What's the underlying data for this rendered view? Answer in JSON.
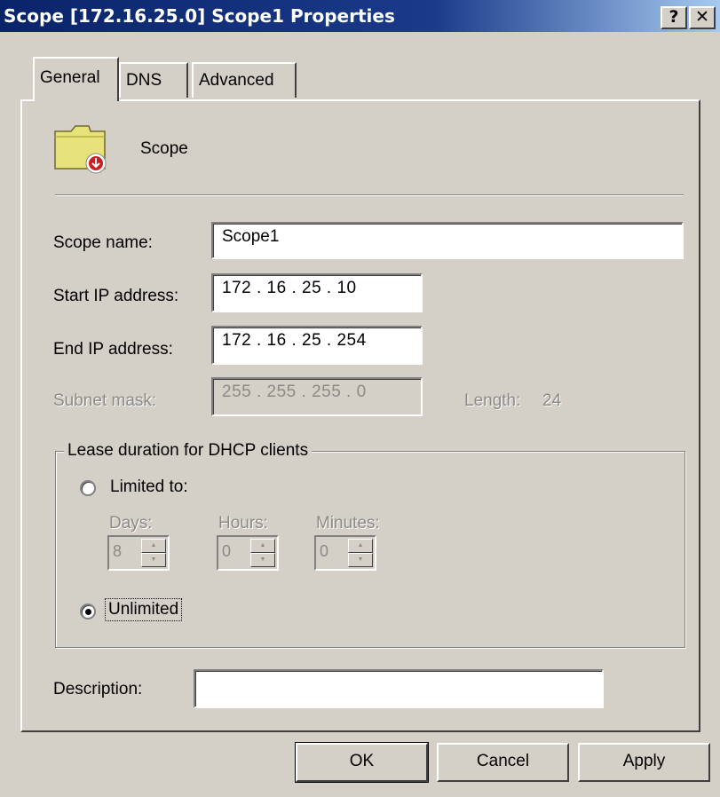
{
  "window": {
    "title": "Scope [172.16.25.0] Scope1 Properties",
    "help_label": "?",
    "close_label": "✕"
  },
  "tabs": [
    {
      "label": "General",
      "active": true
    },
    {
      "label": "DNS",
      "active": false
    },
    {
      "label": "Advanced",
      "active": false
    }
  ],
  "header": {
    "icon": "scope-folder-icon",
    "label": "Scope"
  },
  "form": {
    "scope_name_label": "Scope name:",
    "scope_name_value": "Scope1",
    "start_ip_label": "Start IP address:",
    "start_ip_value": "172 .  16  .  25  .  10",
    "end_ip_label": "End IP address:",
    "end_ip_value": "172 .  16  .  25  . 254",
    "subnet_label": "Subnet mask:",
    "subnet_value": "255 . 255 . 255 .   0",
    "length_label": "Length:",
    "length_value": "24"
  },
  "lease": {
    "group_title": "Lease duration for DHCP clients",
    "limited_label": "Limited to:",
    "limited_selected": false,
    "days_label": "Days:",
    "days_value": "8",
    "hours_label": "Hours:",
    "hours_value": "0",
    "minutes_label": "Minutes:",
    "minutes_value": "0",
    "unlimited_label": "Unlimited",
    "unlimited_selected": true
  },
  "description": {
    "label": "Description:",
    "value": ""
  },
  "buttons": {
    "ok": "OK",
    "cancel": "Cancel",
    "apply": "Apply"
  },
  "colors": {
    "titlebar": "#0a246a",
    "face": "#d4d0c8",
    "disabled_text": "#8c8a85"
  }
}
